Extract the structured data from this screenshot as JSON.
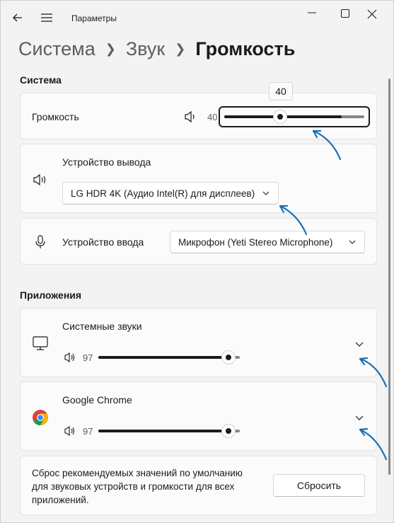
{
  "window": {
    "title": "Параметры"
  },
  "breadcrumb": {
    "items": [
      "Система",
      "Звук"
    ],
    "current": "Громкость"
  },
  "sections": {
    "system": "Система",
    "apps": "Приложения"
  },
  "volume": {
    "label": "Громкость",
    "value": "40",
    "tooltip": "40",
    "level": 0.4
  },
  "output": {
    "label": "Устройство вывода",
    "selected": "LG HDR 4K (Аудио Intel(R) для дисплеев)"
  },
  "input": {
    "label": "Устройство ввода",
    "selected": "Микрофон (Yeti Stereo Microphone)"
  },
  "apps": [
    {
      "name": "Системные звуки",
      "volume": "97",
      "level": 0.97
    },
    {
      "name": "Google Chrome",
      "volume": "97",
      "level": 0.97
    }
  ],
  "reset": {
    "text_line1": "Сброс рекомендуемых значений по умолчанию",
    "text_line2": "для звуковых устройств и громкости для всех",
    "text_line3": "приложений.",
    "button": "Сбросить"
  },
  "colors": {
    "accent": "#1b1b1b",
    "annotation": "#1a6fb5"
  }
}
